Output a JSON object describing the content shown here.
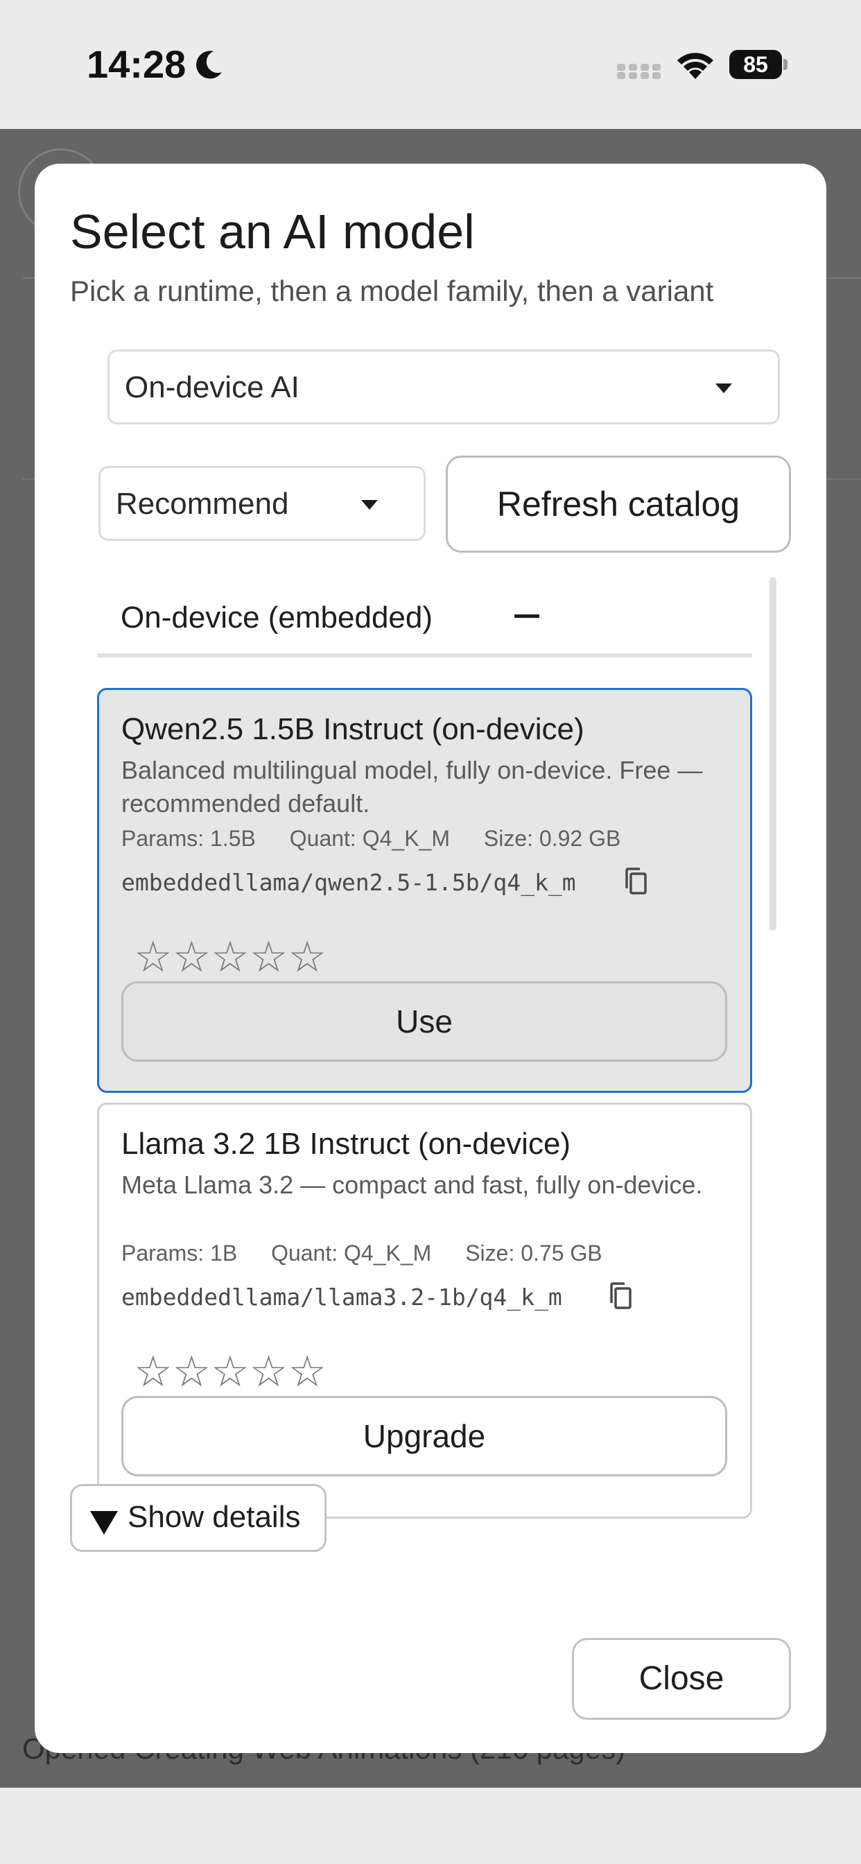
{
  "status_bar": {
    "time": "14:28",
    "battery_level": "85",
    "icons": [
      "moon-icon",
      "cellular-signal-icon",
      "wifi-icon",
      "battery-icon"
    ]
  },
  "background": {
    "bottom_text": "Opened Creating Web Animations (216 pages)"
  },
  "dialog": {
    "title": "Select an AI model",
    "subtitle": "Pick a runtime, then a model family, then a variant",
    "runtime_select": {
      "selected": "On-device AI"
    },
    "sort_select": {
      "selected": "Recommend"
    },
    "refresh_label": "Refresh catalog",
    "group": {
      "label": "On-device (embedded)",
      "collapse_symbol": "—"
    },
    "models": [
      {
        "name": "Qwen2.5 1.5B Instruct (on-device)",
        "description": "Balanced multilingual model, fully on-device. Free — recommended default.",
        "params": "Params: 1.5B",
        "quant": "Quant: Q4_K_M",
        "size": "Size: 0.92 GB",
        "id": "embeddedllama/qwen2.5-1.5b/q4_k_m",
        "stars": "☆☆☆☆☆",
        "rating": 0,
        "action_label": "Use",
        "selected": true
      },
      {
        "name": "Llama 3.2 1B Instruct (on-device)",
        "description": "Meta Llama 3.2 — compact and fast, fully on-device.",
        "params": "Params: 1B",
        "quant": "Quant: Q4_K_M",
        "size": "Size: 0.75 GB",
        "id": "embeddedllama/llama3.2-1b/q4_k_m",
        "stars": "☆☆☆☆☆",
        "rating": 0,
        "action_label": "Upgrade",
        "selected": false
      }
    ],
    "details_label": "Show details",
    "close_label": "Close"
  },
  "colors": {
    "selected_border": "#1a73d0",
    "selected_card_bg": "#e6e6e6",
    "backdrop": "#656565"
  }
}
